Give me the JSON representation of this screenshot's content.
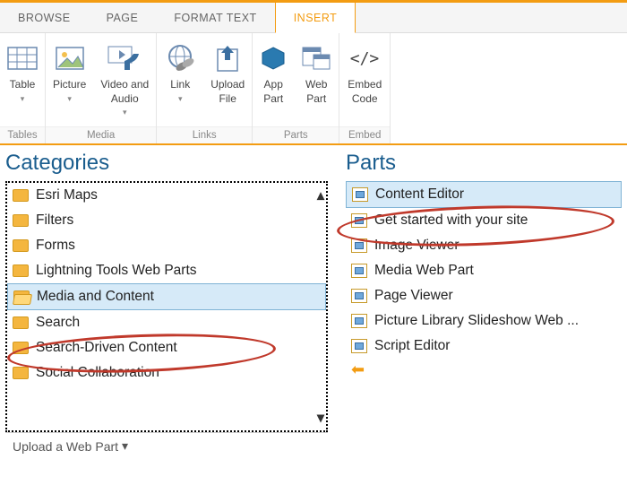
{
  "tabs": {
    "browse": "BROWSE",
    "page": "PAGE",
    "format": "FORMAT TEXT",
    "insert": "INSERT"
  },
  "ribbon": {
    "table": "Table",
    "picture": "Picture",
    "videoaudio": "Video and\nAudio",
    "link": "Link",
    "upload": "Upload\nFile",
    "apppart": "App\nPart",
    "webpart": "Web\nPart",
    "embed": "Embed\nCode",
    "groups": {
      "tables": "Tables",
      "media": "Media",
      "links": "Links",
      "parts": "Parts",
      "embed": "Embed"
    }
  },
  "panels": {
    "categories": "Categories",
    "parts": "Parts"
  },
  "categories": {
    "items": [
      {
        "label": "Esri Maps",
        "selected": false
      },
      {
        "label": "Filters",
        "selected": false
      },
      {
        "label": "Forms",
        "selected": false
      },
      {
        "label": "Lightning Tools Web Parts",
        "selected": false
      },
      {
        "label": "Media and Content",
        "selected": true
      },
      {
        "label": "Search",
        "selected": false
      },
      {
        "label": "Search-Driven Content",
        "selected": false
      },
      {
        "label": "Social Collaboration",
        "selected": false
      }
    ]
  },
  "parts": {
    "items": [
      {
        "label": "Content Editor",
        "selected": true
      },
      {
        "label": "Get started with your site",
        "selected": false
      },
      {
        "label": "Image Viewer",
        "selected": false
      },
      {
        "label": "Media Web Part",
        "selected": false
      },
      {
        "label": "Page Viewer",
        "selected": false
      },
      {
        "label": "Picture Library Slideshow Web ...",
        "selected": false
      },
      {
        "label": "Script Editor",
        "selected": false
      }
    ]
  },
  "upload": {
    "label": "Upload a Web Part"
  }
}
